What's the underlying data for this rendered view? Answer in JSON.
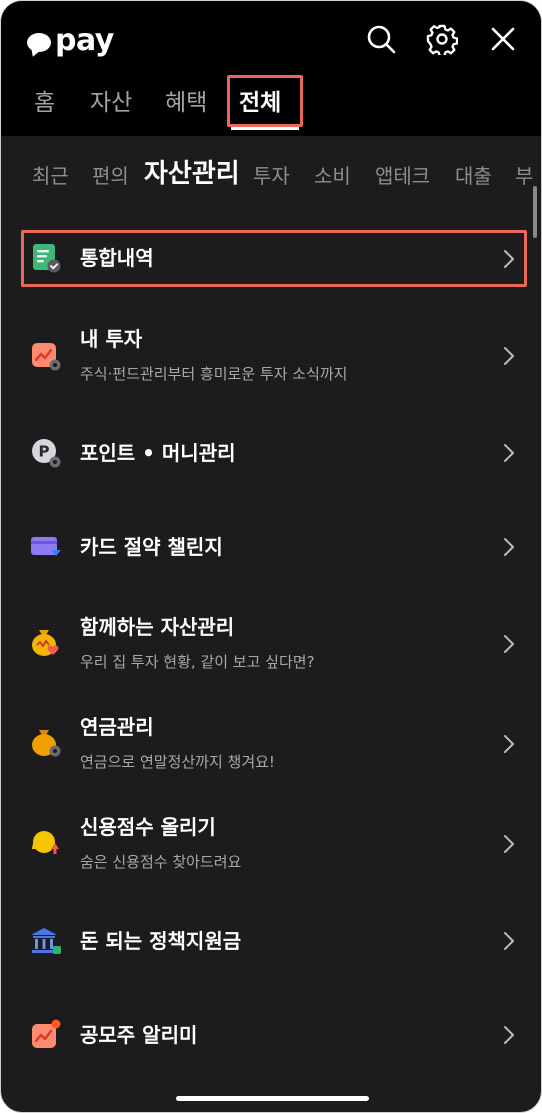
{
  "header": {
    "logo_text": "pay",
    "icons": [
      "search-icon",
      "gear-icon",
      "close-icon"
    ]
  },
  "tabs": [
    {
      "label": "홈"
    },
    {
      "label": "자산"
    },
    {
      "label": "혜택"
    },
    {
      "label": "전체",
      "active": true
    }
  ],
  "subtabs": [
    {
      "label": "최근"
    },
    {
      "label": "편의"
    },
    {
      "label": "자산관리",
      "active": true
    },
    {
      "label": "투자"
    },
    {
      "label": "소비"
    },
    {
      "label": "앱테크"
    },
    {
      "label": "대출"
    },
    {
      "label": "부"
    }
  ],
  "menu": [
    {
      "title": "통합내역",
      "subtitle": "",
      "icon": "document-check-icon"
    },
    {
      "title": "내 투자",
      "subtitle": "주식·펀드관리부터 흥미로운 투자 소식까지",
      "icon": "investment-chart-icon"
    },
    {
      "title": "포인트 • 머니관리",
      "subtitle": "",
      "icon": "point-coin-icon"
    },
    {
      "title": "카드 절약 챌린지",
      "subtitle": "",
      "icon": "card-challenge-icon"
    },
    {
      "title": "함께하는 자산관리",
      "subtitle": "우리 집 투자 현황, 같이 보고 싶다면?",
      "icon": "shared-money-bag-icon"
    },
    {
      "title": "연금관리",
      "subtitle": "연금으로 연말정산까지 챙겨요!",
      "icon": "pension-bag-icon"
    },
    {
      "title": "신용점수 올리기",
      "subtitle": "숨은 신용점수 찾아드려요",
      "icon": "credit-score-icon"
    },
    {
      "title": "돈 되는 정책지원금",
      "subtitle": "",
      "icon": "bank-building-icon"
    },
    {
      "title": "공모주 알리미",
      "subtitle": "",
      "icon": "ipo-alert-icon"
    }
  ],
  "colors": {
    "background": "#1c1c1e",
    "header_background": "#000000",
    "highlight": "#e9685b",
    "text_primary": "#ffffff",
    "text_secondary": "#a8a8aa"
  }
}
